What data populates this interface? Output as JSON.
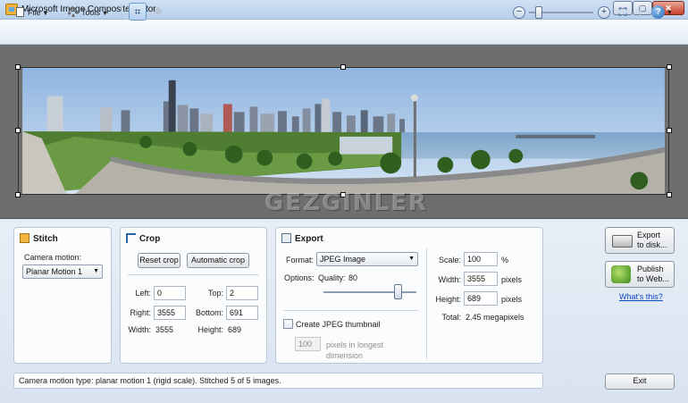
{
  "window": {
    "title": "Microsoft Image Composite Editor",
    "controls": {
      "minimize": "—",
      "maximize": "▢",
      "close": "✕"
    }
  },
  "toolbar": {
    "file_label": "File",
    "tools_label": "Tools",
    "icons": [
      "document-icon",
      "gear-icon",
      "crop-icon",
      "rotate-icon",
      "zoom-out-icon",
      "zoom-in-icon",
      "fit-to-window-icon",
      "help-icon"
    ],
    "zoom_level": 0.15
  },
  "watermark": "GEZGINLER",
  "stitch": {
    "title": "Stitch",
    "camera_motion_label": "Camera motion:",
    "camera_motion_value": "Planar Motion 1"
  },
  "crop": {
    "title": "Crop",
    "reset_label": "Reset crop",
    "auto_label": "Automatic crop",
    "left_label": "Left:",
    "left_value": "0",
    "top_label": "Top:",
    "top_value": "2",
    "right_label": "Right:",
    "right_value": "3555",
    "bottom_label": "Bottom:",
    "bottom_value": "691",
    "width_label": "Width:",
    "width_value": "3555",
    "height_label": "Height:",
    "height_value": "689"
  },
  "export": {
    "title": "Export",
    "format_label": "Format:",
    "format_value": "JPEG Image",
    "options_label": "Options:",
    "quality_label": "Quality:",
    "quality_value": "80",
    "quality_fraction": 0.8,
    "thumbnail_label": "Create JPEG thumbnail",
    "thumbnail_checked": false,
    "thumbnail_size": "100",
    "thumbnail_unit_line1": "pixels in longest",
    "thumbnail_unit_line2": "dimension",
    "scale_label": "Scale:",
    "scale_value": "100",
    "scale_unit": "%",
    "width_label": "Width:",
    "width_value": "3555",
    "width_unit": "pixels",
    "height_label": "Height:",
    "height_value": "689",
    "height_unit": "pixels",
    "total_label": "Total:",
    "total_value": "2.45 megapixels"
  },
  "actions": {
    "export_disk_line1": "Export",
    "export_disk_line2": "to disk...",
    "publish_line1": "Publish",
    "publish_line2": "to Web...",
    "whats_this": "What's this?",
    "exit_label": "Exit"
  },
  "status": "Camera motion type: planar motion 1 (rigid scale). Stitched 5 of 5 images.",
  "colors": {
    "accent": "#356fb1",
    "link": "#0b46c9",
    "canvas_bg": "#6e6e6e",
    "panel_bg": "#fbfcfe"
  }
}
